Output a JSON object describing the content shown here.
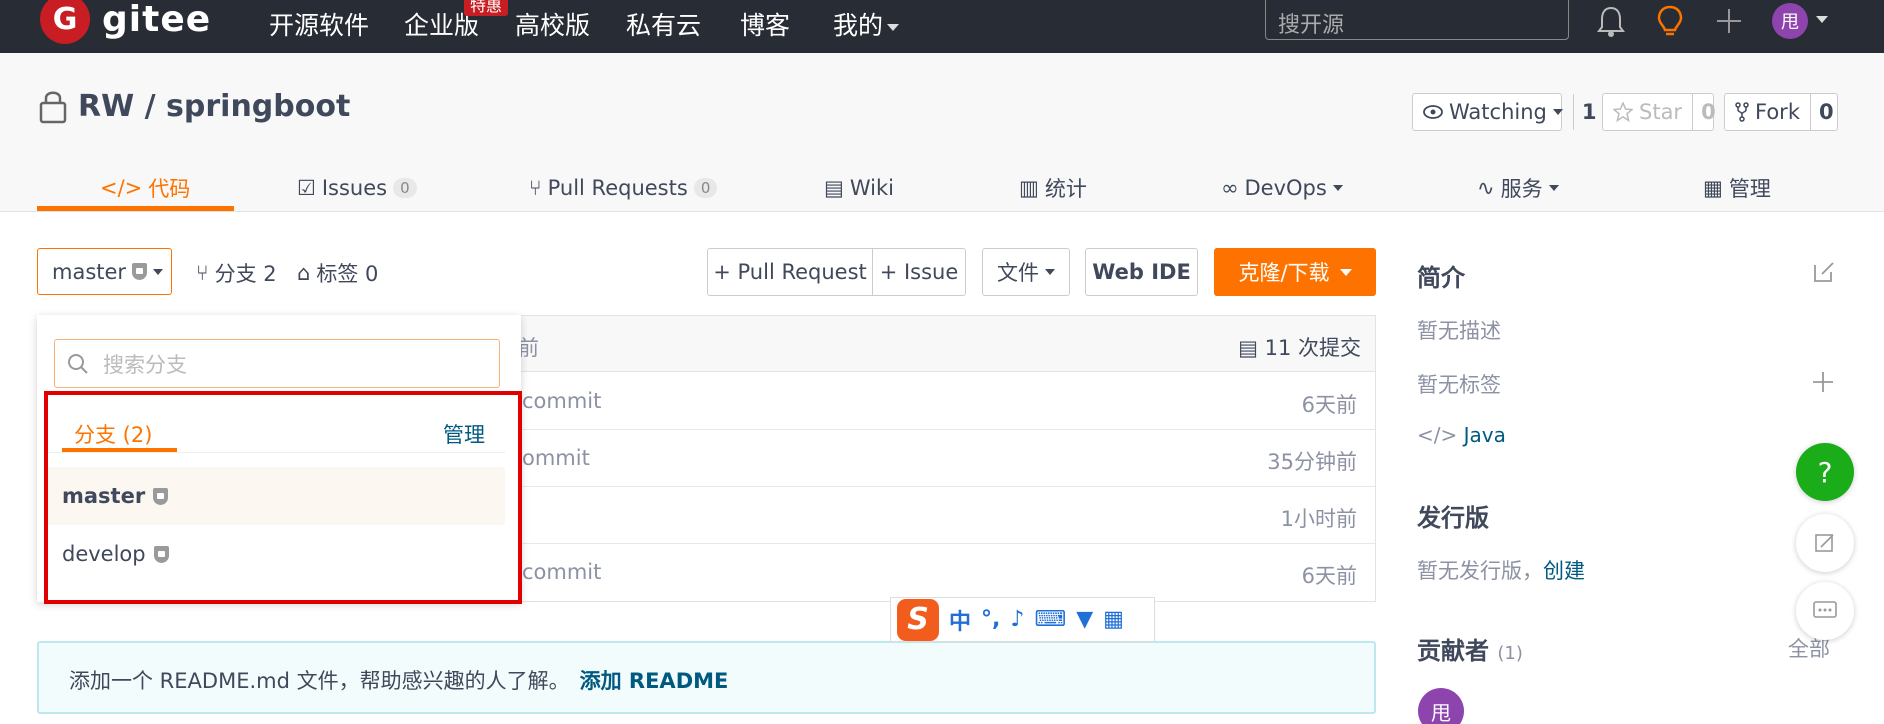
{
  "topnav": {
    "logo_text": "gitee",
    "logo_letter": "G",
    "links": [
      "开源软件",
      "企业版",
      "高校版",
      "私有云",
      "博客",
      "我的"
    ],
    "hot_badge": "特惠",
    "search_placeholder": "搜开源",
    "avatar": "甩"
  },
  "project": {
    "title": "RW / springboot",
    "watching_label": "Watching",
    "watching_count": "1",
    "star_label": "Star",
    "star_count": "0",
    "fork_label": "Fork",
    "fork_count": "0"
  },
  "tabs": [
    {
      "label": "代码"
    },
    {
      "label": "Issues",
      "badge": "0"
    },
    {
      "label": "Pull Requests",
      "badge": "0"
    },
    {
      "label": "Wiki"
    },
    {
      "label": "统计"
    },
    {
      "label": "DevOps"
    },
    {
      "label": "服务"
    },
    {
      "label": "管理"
    }
  ],
  "toolbar": {
    "branch": "master",
    "branches_label": "分支 2",
    "tags_label": "标签 0",
    "pull_request_btn": "+ Pull Request",
    "issue_btn": "+ Issue",
    "file_btn": "文件",
    "webide_btn": "Web IDE",
    "clone_btn": "克隆/下载"
  },
  "filelist": {
    "head_partial": "前",
    "commits": "11 次提交",
    "rows": [
      {
        "msg": "commit",
        "time": "6天前"
      },
      {
        "msg": "ommit",
        "time": "35分钟前"
      },
      {
        "msg": "",
        "time": "1小时前"
      },
      {
        "msg": "commit",
        "time": "6天前"
      }
    ]
  },
  "readme": {
    "text": "添加一个 README.md 文件，帮助感兴趣的人了解。",
    "link": "添加 README"
  },
  "dropdown": {
    "search_placeholder": "搜索分支",
    "tab_label": "分支 (2)",
    "manage": "管理",
    "branches": [
      "master",
      "develop"
    ]
  },
  "sidebar": {
    "intro_title": "简介",
    "no_desc": "暂无描述",
    "no_tags": "暂无标签",
    "language": "Java",
    "release_title": "发行版",
    "no_release": "暂无发行版，",
    "create": "创建",
    "contributors_title": "贡献者",
    "contributors_count": "(1)",
    "all": "全部",
    "contributor_avatar": "甩"
  },
  "ime": {
    "letter": "S",
    "mode": "中",
    "punct": "°,"
  },
  "colors": {
    "accent": "#fe7300",
    "nav_bg": "#282c34",
    "link": "#005980",
    "help": "#1aac19"
  }
}
